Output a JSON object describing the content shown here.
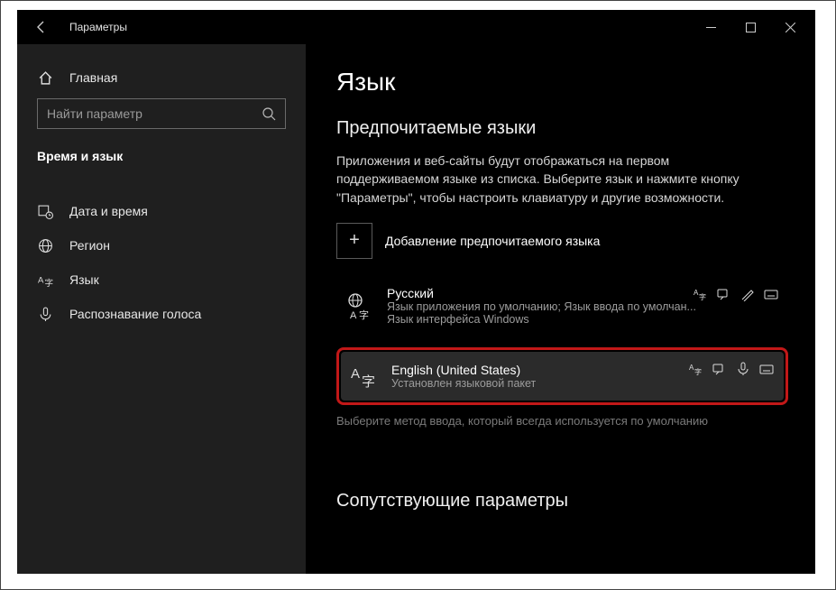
{
  "window": {
    "title": "Параметры"
  },
  "sidebar": {
    "home": "Главная",
    "search_placeholder": "Найти параметр",
    "category": "Время и язык",
    "items": [
      {
        "label": "Дата и время"
      },
      {
        "label": "Регион"
      },
      {
        "label": "Язык"
      },
      {
        "label": "Распознавание голоса"
      }
    ]
  },
  "main": {
    "heading": "Язык",
    "section_title": "Предпочитаемые языки",
    "description": "Приложения и веб-сайты будут отображаться на первом поддерживаемом языке из списка. Выберите язык и нажмите кнопку \"Параметры\", чтобы настроить клавиатуру и другие возможности.",
    "add_label": "Добавление предпочитаемого языка",
    "languages": [
      {
        "name": "Русский",
        "sub1": "Язык приложения по умолчанию; Язык ввода по умолчан...",
        "sub2": "Язык интерфейса Windows"
      },
      {
        "name": "English (United States)",
        "sub1": "Установлен языковой пакет"
      }
    ],
    "hint": "Выберите метод ввода, который всегда используется по умолчанию",
    "related_title": "Сопутствующие параметры"
  }
}
